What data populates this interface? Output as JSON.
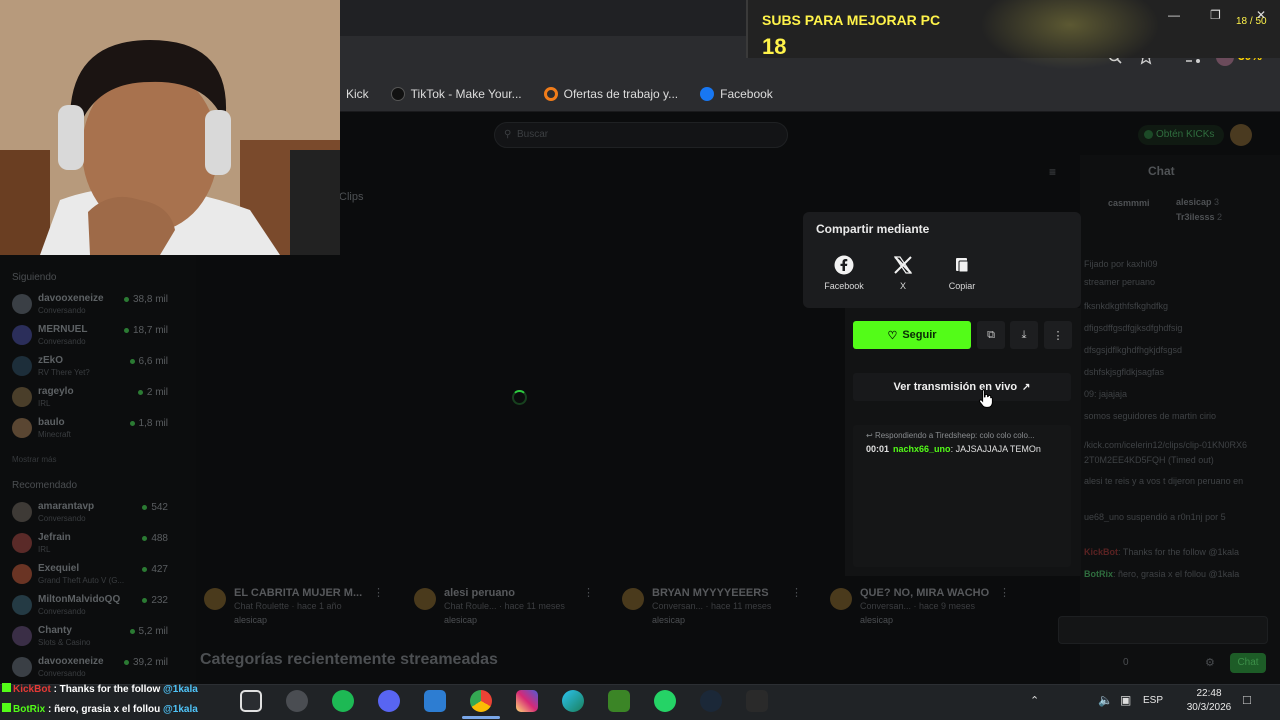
{
  "browser": {
    "bookmarks": [
      {
        "label": "Kick",
        "icon": "kick-icon"
      },
      {
        "label": "TikTok - Make Your...",
        "icon": "tiktok-icon"
      },
      {
        "label": "Ofertas de trabajo y...",
        "icon": "circle-orange-icon"
      },
      {
        "label": "Facebook",
        "icon": "facebook-icon"
      }
    ],
    "window_controls": [
      "minimize-icon",
      "maximize-icon",
      "close-icon"
    ],
    "zoom_text": "30%"
  },
  "overlay": {
    "subs_title": "SUBS PARA MEJORAR PC",
    "subs_count": "18",
    "subs_goal": "18 / 50"
  },
  "header": {
    "search_placeholder": "Buscar",
    "kicks_label": "Obtén KICKs"
  },
  "sidebar": {
    "following_heading": "Siguiendo",
    "following": [
      {
        "name": "davooxeneize",
        "sub": "Conversando",
        "count": "38,8 mil"
      },
      {
        "name": "MERNUEL",
        "sub": "Conversando",
        "count": "18,7 mil"
      },
      {
        "name": "zEkO",
        "sub": "RV There Yet?",
        "count": "6,6 mil"
      },
      {
        "name": "rageylo",
        "sub": "IRL",
        "count": "2 mil"
      },
      {
        "name": "baulo",
        "sub": "Minecraft",
        "count": "1,8 mil"
      }
    ],
    "show_more": "Mostrar más",
    "recommended_heading": "Recomendado",
    "recommended": [
      {
        "name": "amarantavp",
        "sub": "Conversando",
        "count": "542"
      },
      {
        "name": "Jefrain",
        "sub": "IRL",
        "count": "488"
      },
      {
        "name": "Exequiel",
        "sub": "Grand Theft Auto V (G...",
        "count": "427"
      },
      {
        "name": "MiltonMalvidoQQ",
        "sub": "Conversando",
        "count": "232"
      },
      {
        "name": "Chanty",
        "sub": "Slots & Casino",
        "count": "5,2 mil"
      },
      {
        "name": "davooxeneize",
        "sub": "Conversando",
        "count": "39,2 mil"
      }
    ]
  },
  "main": {
    "clips_tab": "Clips",
    "clips": [
      {
        "title": "EL CABRITA MUJER M...",
        "meta": "Chat Roulette · hace 1 año",
        "user": "alesicap"
      },
      {
        "title": "alesi peruano",
        "meta": "Chat Roule... · hace 11 meses",
        "user": "alesicap"
      },
      {
        "title": "BRYAN MYYYYEEERS",
        "meta": "Conversan... · hace 11 meses",
        "user": "alesicap"
      },
      {
        "title": "QUE? NO, MIRA WACHO",
        "meta": "Conversan... · hace 9 meses",
        "user": "alesicap"
      }
    ],
    "categories_heading": "Categorías recientemente streameadas"
  },
  "share": {
    "title": "Compartir mediante",
    "options": [
      {
        "label": "Facebook",
        "icon": "facebook-icon"
      },
      {
        "label": "X",
        "icon": "x-logo-icon"
      },
      {
        "label": "Copiar",
        "icon": "copy-icon"
      }
    ]
  },
  "panel": {
    "follow_label": "Seguir",
    "live_label": "Ver transmisión en vivo",
    "reply_info": "Respondiendo a Tiredsheep: colo colo colo...",
    "reply_time": "00:01",
    "reply_user": "nachx66_uno",
    "reply_text": ": JAJSAJJAJA TEMOn"
  },
  "chat": {
    "title": "Chat",
    "lines": [
      {
        "user": "casmmmi",
        "text": ""
      },
      {
        "user": "alesicap",
        "text": "3"
      },
      {
        "user": "Tr3ilesss",
        "text": "2"
      },
      {
        "user": "",
        "text": "Fijado por kaxhi09"
      },
      {
        "user": "",
        "text": "streamer peruano"
      },
      {
        "user": "",
        "text": "fksnkdkgthfsfkghdfkg"
      },
      {
        "user": "",
        "text": "dfigsdffgsdfgjksdfghdfsig"
      },
      {
        "user": "",
        "text": "dfsgsjdflkghdfhgkjdfsgsd"
      },
      {
        "user": "",
        "text": "dshfskjsgfldkjsagfas"
      },
      {
        "user": "",
        "text": "09: jajajaja"
      },
      {
        "user": "",
        "text": "somos seguidores de martin cirio"
      },
      {
        "user": "",
        "text": "/kick.com/icelerin12/clips/clip-01KN0RX6"
      },
      {
        "user": "",
        "text": "2T0M2EE4KD5FQH (Timed out)"
      },
      {
        "user": "",
        "text": "alesi te reis y a vos t dijeron peruano en"
      },
      {
        "user": "",
        "text": "ue68_uno suspendió a r0n1nj por 5"
      },
      {
        "user": "KickBot",
        "text": ": Thanks for the follow @1kala"
      },
      {
        "user": "BotRix",
        "text": ": ñero, grasia x el follou @1kala"
      }
    ],
    "viewer_count": "0",
    "send_label": "Chat"
  },
  "bottom_overlay": {
    "lines": [
      {
        "user": "KickBot",
        "text": " : Thanks for the follow ",
        "mention": "@1kala"
      },
      {
        "user": "BotRix",
        "text": " : ñero, grasia x el follou ",
        "mention": "@1kala"
      }
    ]
  },
  "taskbar": {
    "lang": "ESP",
    "time": "22:48",
    "date": "30/3/2026"
  },
  "colors": {
    "kick_green": "#53fc18",
    "chrome_dark": "#202124",
    "popup_bg": "#1b1c1e"
  }
}
